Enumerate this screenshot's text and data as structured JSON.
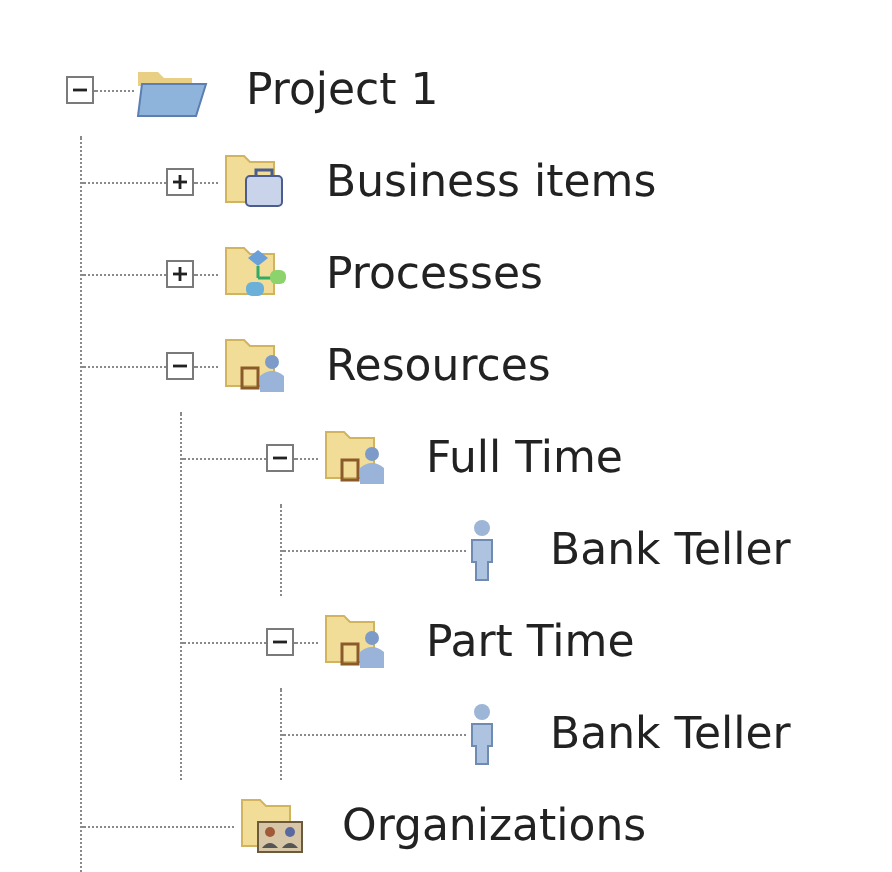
{
  "tree": [
    {
      "label": "Project 1",
      "kind": "project",
      "expanded": true,
      "children": [
        {
          "label": "Business items",
          "kind": "business",
          "expanded": false
        },
        {
          "label": "Processes",
          "kind": "process",
          "expanded": false
        },
        {
          "label": "Resources",
          "kind": "resources",
          "expanded": true,
          "children": [
            {
              "label": "Full Time",
              "kind": "resources",
              "expanded": true,
              "children": [
                {
                  "label": "Bank Teller",
                  "kind": "person"
                }
              ]
            },
            {
              "label": "Part Time",
              "kind": "resources",
              "expanded": true,
              "children": [
                {
                  "label": "Bank Teller",
                  "kind": "person"
                }
              ]
            }
          ]
        },
        {
          "label": "Organizations",
          "kind": "organization"
        }
      ]
    }
  ]
}
